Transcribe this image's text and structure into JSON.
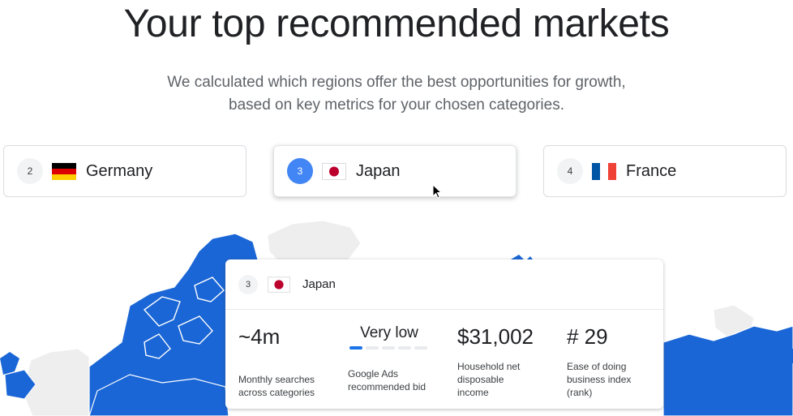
{
  "page": {
    "title": "Your top recommended markets",
    "subtitle_line1": "We calculated which regions offer the best opportunities for growth,",
    "subtitle_line2": "based on key metrics for your chosen categories."
  },
  "markets": [
    {
      "rank": "2",
      "name": "Germany",
      "flag": "germany-flag"
    },
    {
      "rank": "3",
      "name": "Japan",
      "flag": "japan-flag",
      "selected": true
    },
    {
      "rank": "4",
      "name": "France",
      "flag": "france-flag"
    }
  ],
  "details": {
    "rank": "3",
    "name": "Japan",
    "flag": "japan-flag",
    "metrics": {
      "searches": {
        "value": "~4m",
        "label_line1": "Monthly searches",
        "label_line2": "across categories"
      },
      "bid": {
        "value": "Very low",
        "level": 1,
        "level_max": 5,
        "label_line1": "Google Ads",
        "label_line2": "recommended bid"
      },
      "income": {
        "value": "$31,002",
        "label_line1": "Household net",
        "label_line2": "disposable",
        "label_line3": "income"
      },
      "ease": {
        "value": "# 29",
        "label_line1": "Ease of doing",
        "label_line2": "business index",
        "label_line3": "(rank)"
      }
    }
  },
  "colors": {
    "accent": "#4285f4",
    "map_highlight": "#1a66d6",
    "map_base": "#eeeeee",
    "bid_active": "#1a73e8"
  }
}
